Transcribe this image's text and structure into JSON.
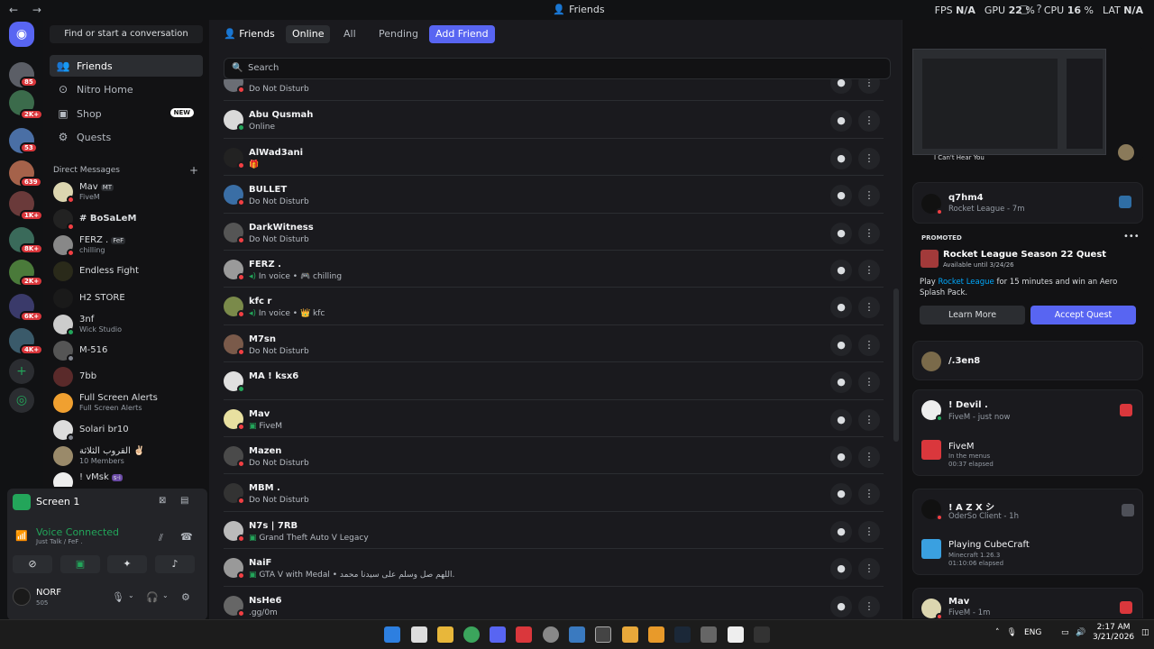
{
  "titlebar": {
    "nav": "← →",
    "title": "Friends",
    "fps_label": "FPS",
    "fps_value": "N/A",
    "gpu_label": "GPU",
    "gpu_value": "22",
    "cpu_label": "CPU",
    "cpu_value": "16",
    "lat_label": "LAT",
    "lat_value": "N/A",
    "percent": "%"
  },
  "rail": {
    "badges": [
      "85",
      "2K+",
      "53",
      "639",
      "1K+",
      "8K+",
      "2K+",
      "6K+",
      "4K+"
    ]
  },
  "sidebar": {
    "search_placeholder": "Find or start a conversation",
    "nav": [
      {
        "label": "Friends",
        "icon": "friends-icon"
      },
      {
        "label": "Nitro Home",
        "icon": "nitro-icon"
      },
      {
        "label": "Shop",
        "icon": "shop-icon",
        "badge": "NEW"
      },
      {
        "label": "Quests",
        "icon": "quests-icon"
      }
    ],
    "dm_header": "Direct Messages",
    "dms": [
      {
        "name": "Mav",
        "tag": "MT",
        "sub": "FiveM"
      },
      {
        "name": "# BoSaLeM",
        "sub": ""
      },
      {
        "name": "FERZ .",
        "tag": "FeF",
        "sub": "chilling"
      },
      {
        "name": "Endless Fight",
        "sub": ""
      },
      {
        "name": "H2 STORE",
        "sub": ""
      },
      {
        "name": "3nf",
        "sub": "Wick Studio"
      },
      {
        "name": "M-516",
        "sub": ""
      },
      {
        "name": "7bb",
        "sub": ""
      },
      {
        "name": "Full Screen Alerts",
        "sub": "Full Screen Alerts"
      },
      {
        "name": "Solari br10",
        "sub": ""
      },
      {
        "name": "القروب الثلاثة ✌🏻",
        "sub": "10 Members"
      },
      {
        "name": "! vMsk",
        "tag": "s-i",
        "sub": ""
      }
    ]
  },
  "voice": {
    "stream_label": "Screen 1",
    "status": "Voice Connected",
    "channel": "Just Talk / FeF .",
    "user": {
      "name": "NORF",
      "sub": "505"
    }
  },
  "topnav": {
    "title": "Friends",
    "tabs": [
      "Online",
      "All",
      "Pending"
    ],
    "add_friend": "Add Friend"
  },
  "main": {
    "search_placeholder": "Search",
    "friends": [
      {
        "name": "",
        "sub": "Do Not Disturb",
        "status": "dnd"
      },
      {
        "name": "Abu Qusmah",
        "sub": "Online",
        "status": "on"
      },
      {
        "name": "AlWad3ani",
        "sub": "🎁",
        "status": "dnd"
      },
      {
        "name": "BULLET",
        "sub": "Do Not Disturb",
        "status": "dnd"
      },
      {
        "name": "DarkWitness",
        "sub": "Do Not Disturb",
        "status": "dnd"
      },
      {
        "name": "FERZ .",
        "sub": "In voice • 🎮 chilling",
        "status": "dnd",
        "voice": true
      },
      {
        "name": "kfc r",
        "sub": "In voice • 👑 kfc",
        "status": "dnd",
        "voice": true
      },
      {
        "name": "M7sn",
        "sub": "Do Not Disturb",
        "status": "dnd"
      },
      {
        "name": "MA ! ksx6",
        "sub": "",
        "status": "on"
      },
      {
        "name": "Mav",
        "sub": "FiveM",
        "status": "dnd",
        "game": true
      },
      {
        "name": "Mazen",
        "sub": "Do Not Disturb",
        "status": "dnd"
      },
      {
        "name": "MBM .",
        "sub": "Do Not Disturb",
        "status": "dnd"
      },
      {
        "name": "N7s | 7RB",
        "sub": "Grand Theft Auto V Legacy",
        "status": "dnd",
        "game": true
      },
      {
        "name": "NaiF",
        "sub": "GTA V with Medal • اللهم صل وسلم على سيدنا محمد.",
        "status": "dnd",
        "game": true
      },
      {
        "name": "NsHe6",
        "sub": ".gg/0m",
        "status": "dnd"
      }
    ]
  },
  "activity": {
    "stream_caption": "I Can't Hear You",
    "q7hm4": {
      "name": "q7hm4",
      "sub": "Rocket League - 7m"
    },
    "promoted": "PROMOTED",
    "quest_title": "Rocket League Season 22 Quest",
    "quest_avail": "Available until 3/24/26",
    "quest_desc_1": "Play ",
    "quest_desc_link": "Rocket League",
    "quest_desc_2": " for 15 minutes and win an Aero Splash Pack.",
    "learn_more": "Learn More",
    "accept": "Accept Quest",
    "jen8": "/.3en8",
    "devil": {
      "name": "! Devil .",
      "sub": "FiveM - just now",
      "game": "FiveM",
      "game_sub1": "In the menus",
      "game_sub2": "00:37 elapsed"
    },
    "azx": {
      "name": "! A Z X シ",
      "sub": "OderSo Client - 1h",
      "game": "Playing CubeCraft",
      "game_sub1": "Minecraft 1.26.3",
      "game_sub2": "01:10:06 elapsed"
    },
    "mav": {
      "name": "Mav",
      "sub": "FiveM - 1m"
    }
  },
  "taskbar": {
    "lang": "ENG",
    "time": "2:17 AM",
    "date": "3/21/2026"
  }
}
